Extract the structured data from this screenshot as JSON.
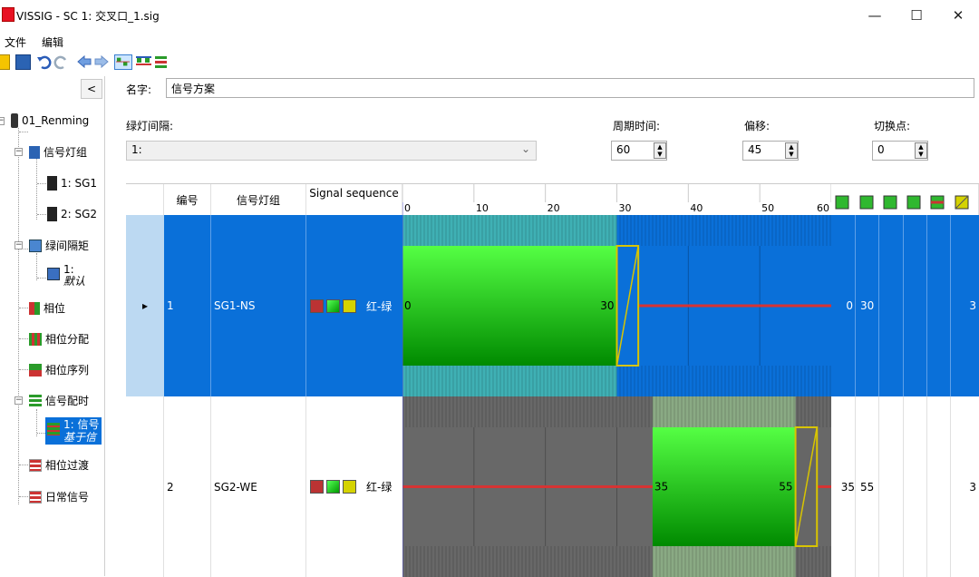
{
  "window": {
    "title": "VISSIG - SC 1: 交叉口_1.sig",
    "controls": [
      "—",
      "☐",
      "✕"
    ]
  },
  "menu": {
    "items": [
      "文件",
      "编辑"
    ]
  },
  "tree": {
    "collapse_label": "<",
    "root": "01_Renming",
    "nodes": [
      {
        "label": "信号灯组",
        "level": 1
      },
      {
        "label": "1: SG1",
        "level": 2
      },
      {
        "label": "2: SG2",
        "level": 2
      },
      {
        "label": "绿间隔矩",
        "level": 1
      },
      {
        "label": "1:",
        "label2": "默认",
        "level": 2
      },
      {
        "label": "相位",
        "level": 1
      },
      {
        "label": "相位分配",
        "level": 1
      },
      {
        "label": "相位序列",
        "level": 1
      },
      {
        "label": "信号配时",
        "level": 1
      },
      {
        "label": "1: 信号",
        "label2": "基于信",
        "level": 2
      },
      {
        "label": "相位过渡",
        "level": 1
      },
      {
        "label": "日常信号",
        "level": 1
      }
    ]
  },
  "form": {
    "name_label": "名字:",
    "name_value": "信号方案",
    "intergreen_label": "绿灯间隔:",
    "intergreen_value": "1:",
    "cycle_label": "周期时间:",
    "cycle_value": "60",
    "offset_label": "偏移:",
    "offset_value": "45",
    "switch_label": "切换点:",
    "switch_value": "0"
  },
  "grid": {
    "headers": {
      "number": "编号",
      "group": "信号灯组",
      "sequence": "Signal sequence",
      "axis_ticks": [
        "0",
        "10",
        "20",
        "30",
        "40",
        "50",
        "60"
      ]
    },
    "rows": [
      {
        "marker": "▸",
        "number": "1",
        "group": "SG1-NS",
        "sequence_text": "红-绿",
        "green_start": 0,
        "green_end": 30,
        "amber_end": 33,
        "start_label": "0",
        "end_label": "30",
        "col_a": "0",
        "col_b": "30",
        "col_last": "3",
        "selected": true
      },
      {
        "marker": "",
        "number": "2",
        "group": "SG2-WE",
        "sequence_text": "红-绿",
        "green_start": 35,
        "green_end": 55,
        "amber_end": 58,
        "start_label": "35",
        "end_label": "55",
        "col_a": "35",
        "col_b": "55",
        "col_last": "3",
        "selected": false
      }
    ],
    "colors": {
      "selected_bg": "#0a70d9",
      "dark_bg": "#686868",
      "green_top": "#55ff44",
      "green_bottom": "#008a00",
      "red_line": "#d63333",
      "amber": "#d8c400"
    }
  }
}
